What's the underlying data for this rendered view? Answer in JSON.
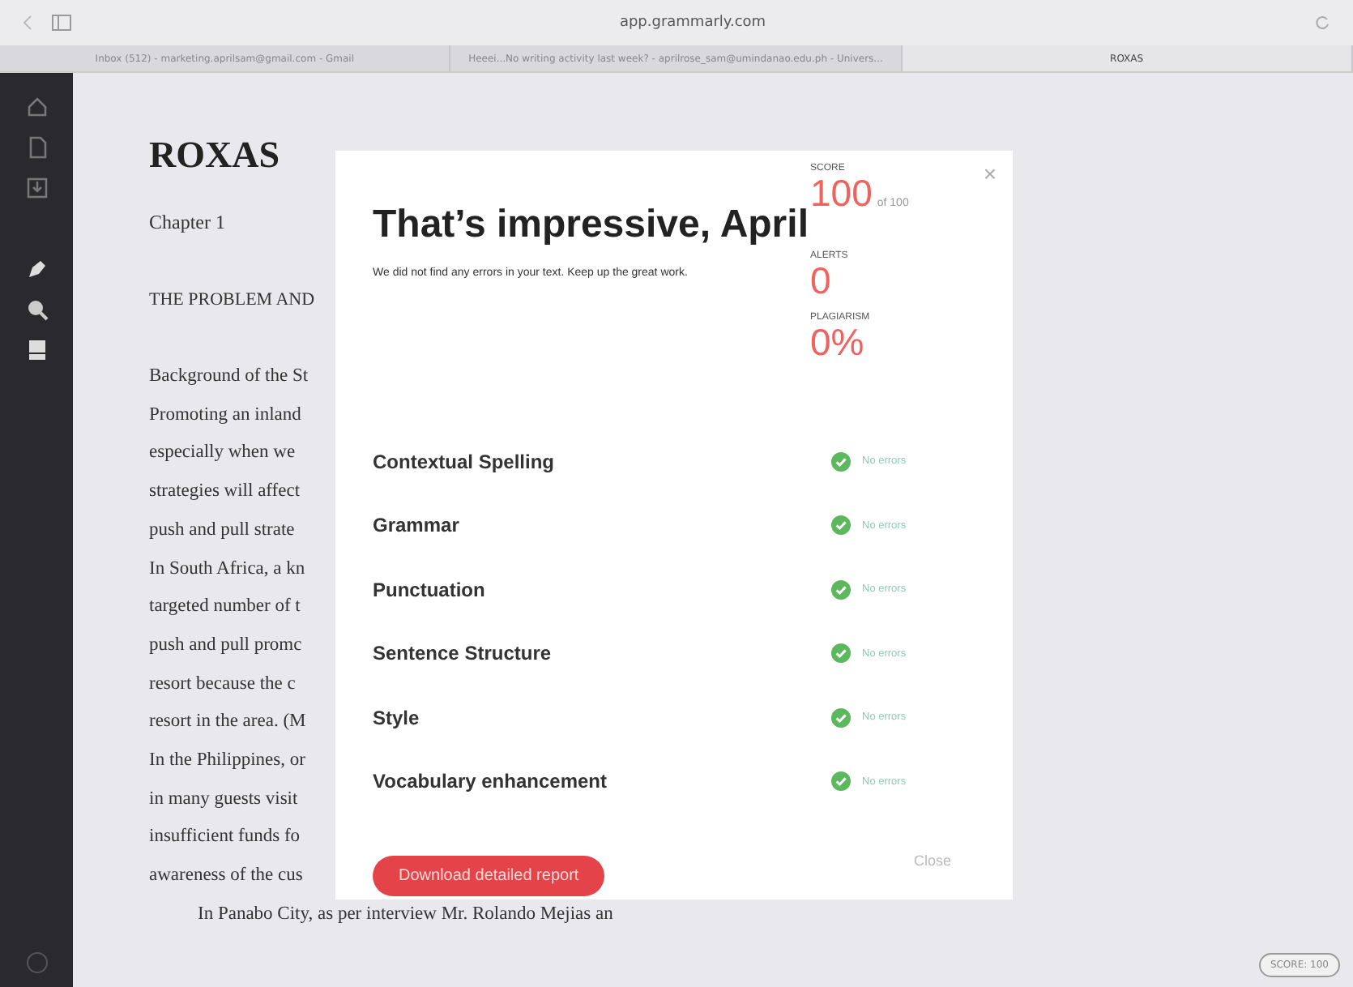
{
  "browser": {
    "url": "app.grammarly.com",
    "tabs": [
      {
        "label": "Inbox (512) - marketing.aprilsam@gmail.com - Gmail",
        "selected": false
      },
      {
        "label": "Heeei...No writing activity last week? - aprilrose_sam@umindanao.edu.ph - Univers...",
        "selected": false
      },
      {
        "label": "ROXAS",
        "selected": true
      }
    ]
  },
  "document": {
    "title": "ROXAS",
    "chapter": "Chapter 1",
    "heading": "THE PROBLEM AND",
    "lines": [
      "Background of the St",
      "Promoting an inland",
      "especially when we",
      "strategies will affect",
      "push and pull strate",
      "In South Africa, a kn",
      "targeted number of t",
      "push and pull promc",
      "resort because the c",
      "resort in the area. (M",
      "In the Philippines, or",
      "in many guests visit",
      "insufficient funds fo",
      "awareness of the cus"
    ],
    "paragraph": "In Panabo City, as per interview Mr. Rolando Mejias an"
  },
  "dialog": {
    "title": "That’s impressive, April",
    "message": "We did not find any errors in your text. Keep up the great work.",
    "stats": [
      {
        "label": "SCORE",
        "value": "100",
        "suffix": "of 100"
      },
      {
        "label": "ALERTS",
        "value": "0"
      },
      {
        "label": "PLAGIARISM",
        "value": "0%"
      }
    ],
    "checks": [
      {
        "name": "Contextual Spelling",
        "result": "No errors"
      },
      {
        "name": "Grammar",
        "result": "No errors"
      },
      {
        "name": "Punctuation",
        "result": "No errors"
      },
      {
        "name": "Sentence Structure",
        "result": "No errors"
      },
      {
        "name": "Style",
        "result": "No errors"
      },
      {
        "name": "Vocabulary enhancement",
        "result": "No errors"
      }
    ],
    "download_button": "Download detailed report",
    "close_link": "Close",
    "close_icon": "×"
  },
  "score_badge": "SCORE: 100"
}
